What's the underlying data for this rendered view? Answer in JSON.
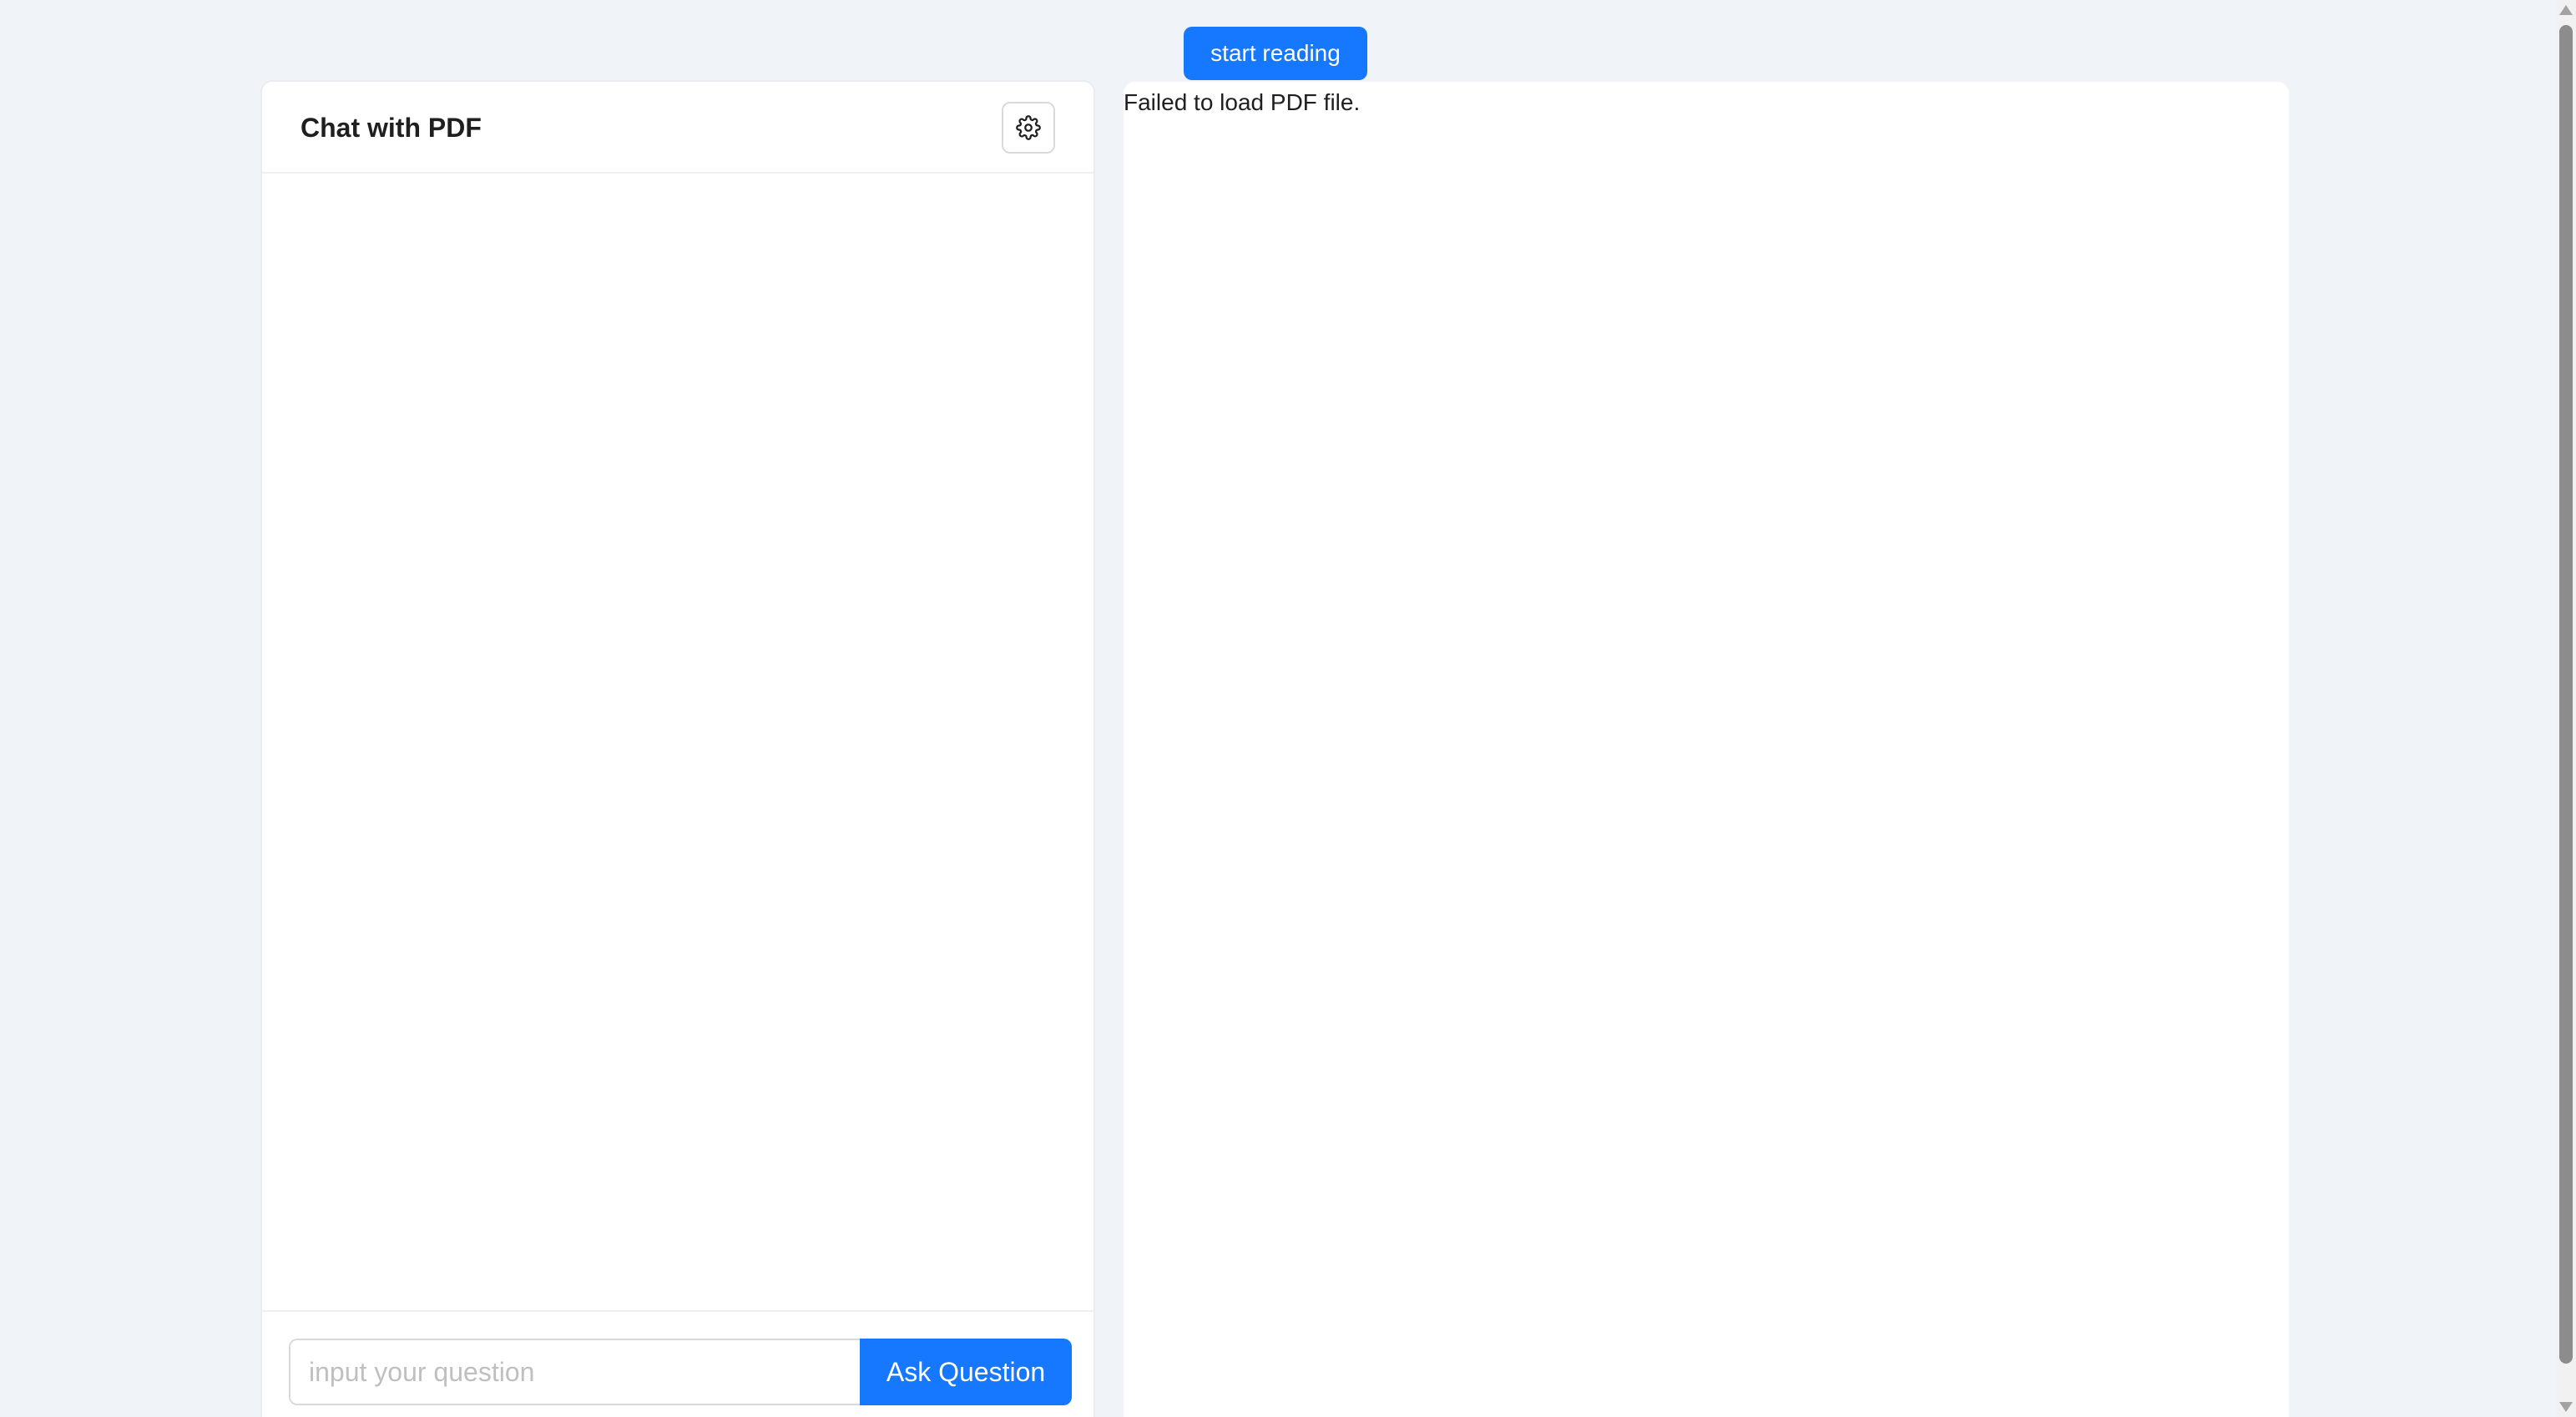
{
  "toolbar": {
    "start_label": "start reading"
  },
  "chat": {
    "title": "Chat with PDF",
    "settings_icon": "gear-icon",
    "input_placeholder": "input your question",
    "input_value": "",
    "ask_label": "Ask Question"
  },
  "viewer": {
    "error_text": "Failed to load PDF file."
  },
  "colors": {
    "accent": "#1677ff",
    "background": "#f0f4f9",
    "panel": "#ffffff"
  }
}
